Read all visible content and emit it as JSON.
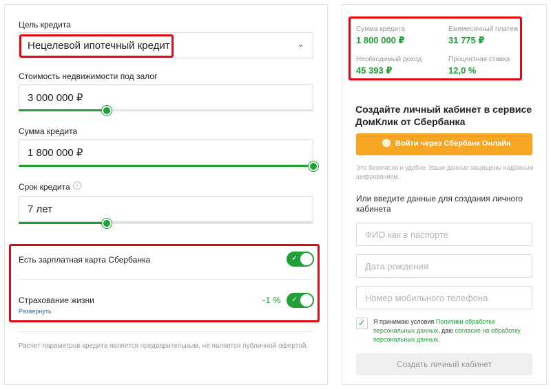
{
  "form": {
    "purpose_label": "Цель кредита",
    "purpose_value": "Нецелевой ипотечный кредит",
    "property_label": "Стоимость недвижимости под залог",
    "property_value": "3 000 000 ₽",
    "property_slider_fraction": 0.3,
    "amount_label": "Сумма кредита",
    "amount_value": "1 800 000 ₽",
    "amount_slider_fraction": 1.0,
    "term_label": "Срок кредита",
    "term_value": "7 лет",
    "term_slider_fraction": 0.3,
    "salary_card_label": "Есть зарплатная карта Сбербанка",
    "insurance_label": "Страхование жизни",
    "insurance_discount": "-1 %",
    "expand_link": "Развернуть",
    "disclaimer": "Расчет параметров кредита является предварительным, не является публичной офертой."
  },
  "summary": {
    "amount_label": "Сумма кредита",
    "amount_value": "1 800 000 ₽",
    "payment_label": "Ежемесячный платеж",
    "payment_value": "31 775 ₽",
    "income_label": "Необходимый доход",
    "income_value": "45 393 ₽",
    "rate_label": "Процентная ставка",
    "rate_value": "12,0 %"
  },
  "signup": {
    "title": "Создайте личный кабинет в сервисе ДомКлик от Сбербанка",
    "sber_button": "Войти через Сбербанк Онлайн",
    "secure_note": "Это безопасно и удобно. Ваши данные защищены надёжным шифрованием.",
    "or_text": "Или введите данные для создания личного кабинета",
    "name_placeholder": "ФИО как в паспорте",
    "birth_placeholder": "Дата рождения",
    "phone_placeholder": "Номер мобильного телефона",
    "consent_prefix": "Я принимаю условия",
    "consent_link1": "Политики обработки персональных данных",
    "consent_middle": ", даю",
    "consent_link2": "согласие на обработку персональных данных",
    "consent_suffix": ".",
    "create_button": "Создать личный кабинет"
  },
  "colors": {
    "accent": "#21a038",
    "highlight": "#e30613",
    "sber_button": "#f6a623"
  }
}
